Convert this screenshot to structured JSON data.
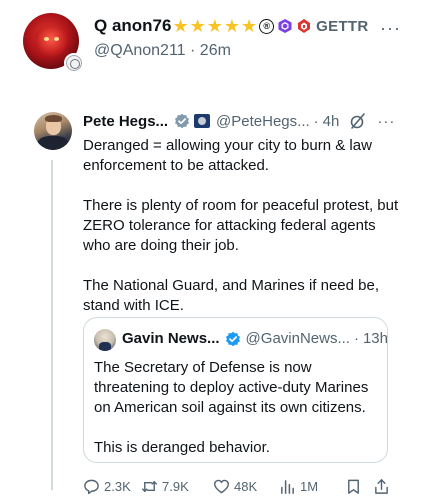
{
  "outer_post": {
    "display_name": "Q anon76",
    "star_count": 5,
    "registered_mark": "®",
    "platform_label": "GETTR",
    "handle": "@QAnon211",
    "separator": "·",
    "time": "26m",
    "more_icon": "ellipsis-icon"
  },
  "quoted_post": {
    "display_name": "Pete Hegs...",
    "handle": "@PeteHegs...",
    "separator": "·",
    "time": "4h",
    "paragraphs": [
      "Deranged = allowing your city to burn & law enforcement to be attacked.",
      "There is plenty of room for peaceful protest, but ZERO tolerance for attacking federal agents who are doing their job.",
      "The National Guard, and Marines if need be, stand with ICE."
    ]
  },
  "nested_quote": {
    "display_name": "Gavin News...",
    "handle": "@GavinNews...",
    "separator": "·",
    "time": "13h",
    "paragraphs": [
      "The Secretary of Defense is now threatening to deploy active-duty Marines on American soil against its own citizens.",
      "This is deranged behavior."
    ]
  },
  "actions": {
    "replies": "2.3K",
    "reposts": "7.9K",
    "likes": "48K",
    "views": "1M"
  },
  "colors": {
    "text": "#0f1419",
    "secondary": "#536471",
    "border": "#cfd9de",
    "verified_blue": "#1d9bf0",
    "star_gold": "#f7c325"
  }
}
